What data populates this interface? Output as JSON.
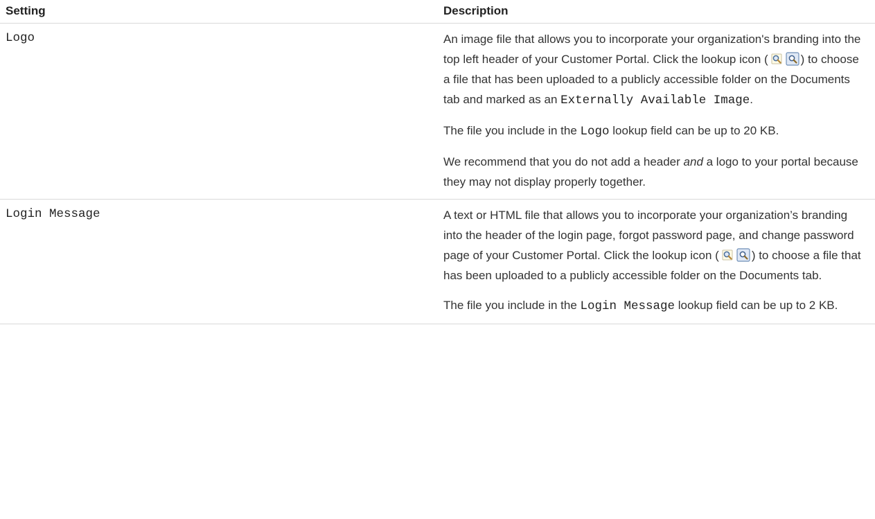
{
  "table": {
    "headers": {
      "setting": "Setting",
      "description": "Description"
    },
    "rows": [
      {
        "setting": "Logo",
        "p1": {
          "a": "An image file that allows you to incorporate your organization's branding into the top left header of your Customer Portal. Click the lookup icon (",
          "b": ") to choose a file that has been uploaded to a publicly accessible folder on the Documents tab and marked as an ",
          "code": "Externally Available Image",
          "c": "."
        },
        "p2": {
          "a": "The file you include in the ",
          "code": "Logo",
          "b": " lookup field can be up to 20 KB."
        },
        "p3": {
          "a": "We recommend that you do not add a header ",
          "em": "and",
          "b": " a logo to your portal because they may not display properly together."
        }
      },
      {
        "setting": "Login Message",
        "p1": {
          "a": "A text or HTML file that allows you to incorporate your organization’s branding into the header of the login page, forgot password page, and change password page of your Customer Portal. Click the lookup icon (",
          "b": ") to choose a file that has been uploaded to a publicly accessible folder on the Documents tab."
        },
        "p2": {
          "a": "The file you include in the ",
          "code": "Login Message",
          "b": " lookup field can be up to 2 KB."
        }
      }
    ]
  },
  "icons": [
    "lookup-icon",
    "lookup-icon-hover"
  ]
}
